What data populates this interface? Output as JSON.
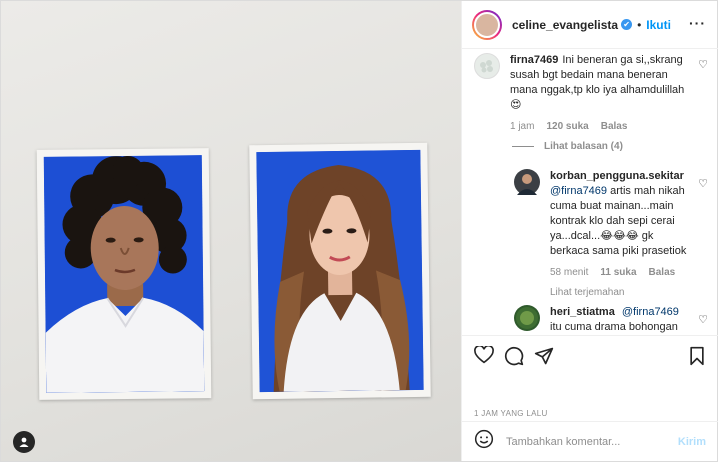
{
  "header": {
    "username": "celine_evangelista",
    "verified_mark": "✔",
    "separator": "•",
    "follow_label": "Ikuti",
    "more_icon": "more-horizontal-icon"
  },
  "comments": [
    {
      "username": "firna7469",
      "text": "Ini beneran ga si,,skrang susah bgt bedain mana beneran mana nggak,tp klo iya alhamdulillah",
      "emoji": "😍",
      "time": "1 jam",
      "likes": "120 suka",
      "reply_label": "Balas",
      "view_replies": "Lihat balasan (4)"
    },
    {
      "username": "korban_pengguna.sekitar",
      "mention": "@firna7469",
      "text": "artis mah nikah cuma buat mainan...main kontrak klo dah sepi cerai ya...dcal...😂😂😂 gk berkaca sama piki prasetiok",
      "time": "58 menit",
      "likes": "11 suka",
      "reply_label": "Balas",
      "translate_label": "Lihat terjemahan"
    },
    {
      "username": "heri_stiatma",
      "mention": "@firna7469",
      "text": "itu cuma drama bohongan"
    }
  ],
  "post": {
    "timestamp": "1 JAM YANG LALU"
  },
  "composer": {
    "placeholder": "Tambahkan komentar...",
    "send_label": "Kirim"
  },
  "colors": {
    "accent": "#0095f6",
    "photo_background_blue": "#1c4fd6"
  }
}
